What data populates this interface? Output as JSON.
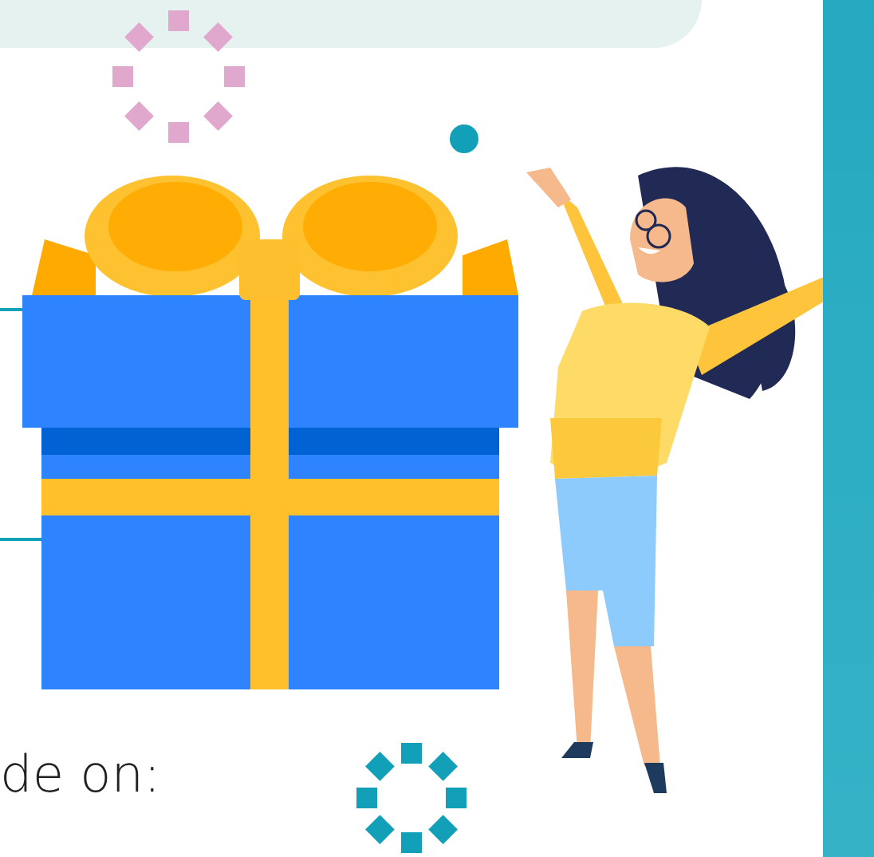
{
  "caption": {
    "text": "de on:"
  }
}
